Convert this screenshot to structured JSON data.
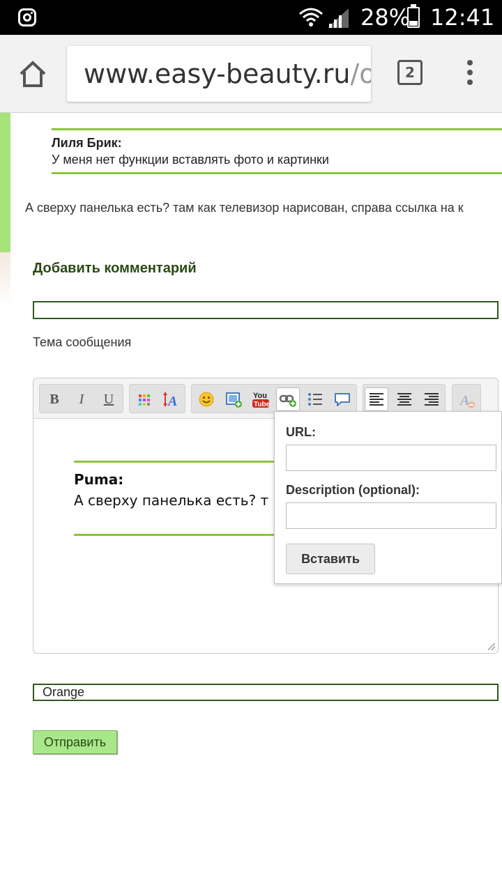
{
  "status_bar": {
    "battery": "28%",
    "time": "12:41",
    "icons": [
      "instagram-icon",
      "wifi-icon",
      "signal-icon",
      "battery-icon"
    ]
  },
  "browser": {
    "url_host": "www.easy-beauty.ru",
    "url_rest": "/ob",
    "tab_count": "2"
  },
  "thread": {
    "quoted_author": "Лиля Брик:",
    "quoted_text": "У меня нет функции вставлять фото и картинки",
    "reply_text": "А сверху панелька есть? там как телевизор нарисован, справа ссылка на к"
  },
  "comment_form": {
    "title": "Добавить комментарий",
    "subject_label": "Тема сообщения",
    "subject_value": "",
    "name_value": "Orange",
    "submit_label": "Отправить"
  },
  "editor": {
    "toolbar": {
      "bold": "B",
      "italic": "I",
      "underline": "U"
    },
    "quote_author": "Puma:",
    "quote_text": "А сверху панелька есть? т нарисован, справа ссылка"
  },
  "link_popup": {
    "url_label": "URL:",
    "url_value": "",
    "description_label": "Description (optional):",
    "description_value": "",
    "insert_label": "Вставить"
  },
  "colors": {
    "accent_green": "#8ac53d",
    "dark_green": "#2d5a1a",
    "submit_bg": "#a9e88a"
  }
}
